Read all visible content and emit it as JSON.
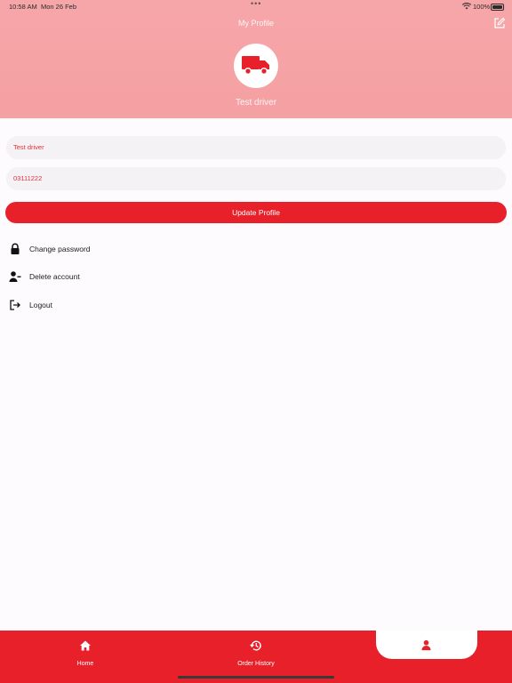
{
  "status_bar": {
    "time": "10:58 AM",
    "date": "Mon 26 Feb",
    "battery": "100%"
  },
  "header": {
    "title": "My Profile",
    "driver_name": "Test driver"
  },
  "form": {
    "name_value": "Test driver",
    "phone_value": "03111222",
    "update_label": "Update Profile"
  },
  "menu": [
    {
      "label": "Change password",
      "icon": "lock-icon"
    },
    {
      "label": "Delete account",
      "icon": "user-minus-icon"
    },
    {
      "label": "Logout",
      "icon": "logout-icon"
    }
  ],
  "bottom_nav": {
    "home_label": "Home",
    "history_label": "Order History",
    "active": "profile"
  },
  "colors": {
    "header": "#f5a0a3",
    "primary": "#e8202a",
    "field_bg": "#f4f2f4"
  }
}
